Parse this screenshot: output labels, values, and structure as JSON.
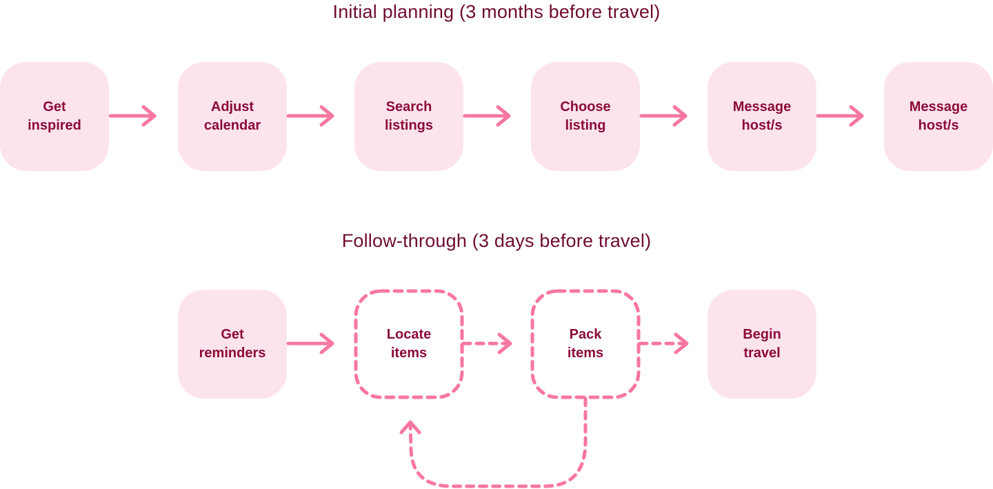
{
  "sections": [
    {
      "title": "Initial planning (3 months before travel)",
      "steps": [
        {
          "label": "Get\ninspired",
          "style": "solid"
        },
        {
          "label": "Adjust\ncalendar",
          "style": "solid"
        },
        {
          "label": "Search\nlistings",
          "style": "solid"
        },
        {
          "label": "Choose\nlisting",
          "style": "solid"
        },
        {
          "label": "Message\nhost/s",
          "style": "solid"
        },
        {
          "label": "Message\nhost/s",
          "style": "solid"
        }
      ]
    },
    {
      "title": "Follow-through (3 days before travel)",
      "steps": [
        {
          "label": "Get\nreminders",
          "style": "solid"
        },
        {
          "label": "Locate\nitems",
          "style": "dashed"
        },
        {
          "label": "Pack\nitems",
          "style": "dashed"
        },
        {
          "label": "Begin\ntravel",
          "style": "solid"
        }
      ],
      "loop": {
        "from": "Pack items",
        "to": "Locate items",
        "style": "dashed"
      }
    }
  ],
  "colors": {
    "title": "#6e0c2f",
    "node_text": "#8b0a3a",
    "node_fill": "#fde4ec",
    "arrow": "#f7779f"
  }
}
